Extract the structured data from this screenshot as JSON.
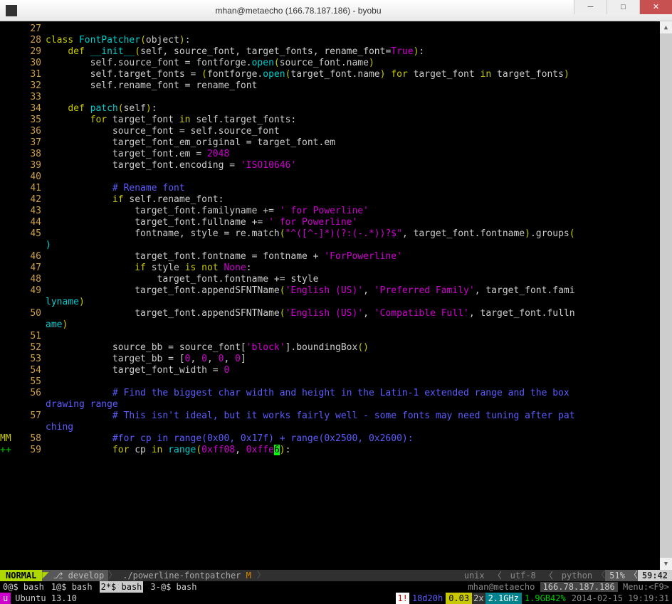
{
  "window": {
    "title": "mhan@metaecho (166.78.187.186) - byobu",
    "minimize": "─",
    "maximize": "□",
    "close": "✕"
  },
  "gutter": {
    "start": 27,
    "end": 59
  },
  "signs": {
    "58": "MM",
    "59": "++"
  },
  "code": {
    "lines": [
      {
        "n": 27,
        "raw": ""
      },
      {
        "n": 28,
        "segs": [
          [
            "kw",
            "class"
          ],
          [
            "op",
            " "
          ],
          [
            "cls",
            "FontPatcher"
          ],
          [
            "paren",
            "("
          ],
          [
            "op",
            "object"
          ],
          [
            "paren",
            ")"
          ],
          [
            "op",
            ":"
          ]
        ]
      },
      {
        "n": 29,
        "segs": [
          [
            "op",
            "    "
          ],
          [
            "kw",
            "def"
          ],
          [
            "op",
            " "
          ],
          [
            "fn",
            "__init__"
          ],
          [
            "paren",
            "("
          ],
          [
            "op",
            "self, source_font, target_fonts, rename_font="
          ],
          [
            "bool",
            "True"
          ],
          [
            "paren",
            ")"
          ],
          [
            "op",
            ":"
          ]
        ]
      },
      {
        "n": 30,
        "segs": [
          [
            "op",
            "        self.source_font = fontforge."
          ],
          [
            "fn",
            "open"
          ],
          [
            "paren",
            "("
          ],
          [
            "op",
            "source_font.name"
          ],
          [
            "paren",
            ")"
          ]
        ]
      },
      {
        "n": 31,
        "segs": [
          [
            "op",
            "        self.target_fonts = "
          ],
          [
            "paren",
            "("
          ],
          [
            "op",
            "fontforge."
          ],
          [
            "fn",
            "open"
          ],
          [
            "paren",
            "("
          ],
          [
            "op",
            "target_font.name"
          ],
          [
            "paren",
            ")"
          ],
          [
            "op",
            " "
          ],
          [
            "kw",
            "for"
          ],
          [
            "op",
            " target_font "
          ],
          [
            "kw",
            "in"
          ],
          [
            "op",
            " target_fonts"
          ],
          [
            "paren",
            ")"
          ]
        ]
      },
      {
        "n": 32,
        "segs": [
          [
            "op",
            "        self.rename_font = rename_font"
          ]
        ]
      },
      {
        "n": 33,
        "raw": ""
      },
      {
        "n": 34,
        "segs": [
          [
            "op",
            "    "
          ],
          [
            "kw",
            "def"
          ],
          [
            "op",
            " "
          ],
          [
            "fn",
            "patch"
          ],
          [
            "paren",
            "("
          ],
          [
            "op",
            "self"
          ],
          [
            "paren",
            ")"
          ],
          [
            "op",
            ":"
          ]
        ]
      },
      {
        "n": 35,
        "segs": [
          [
            "op",
            "        "
          ],
          [
            "kw",
            "for"
          ],
          [
            "op",
            " target_font "
          ],
          [
            "kw",
            "in"
          ],
          [
            "op",
            " self.target_fonts:"
          ]
        ]
      },
      {
        "n": 36,
        "segs": [
          [
            "op",
            "            source_font = self.source_font"
          ]
        ]
      },
      {
        "n": 37,
        "segs": [
          [
            "op",
            "            target_font_em_original = target_font.em"
          ]
        ]
      },
      {
        "n": 38,
        "segs": [
          [
            "op",
            "            target_font.em = "
          ],
          [
            "num",
            "2048"
          ]
        ]
      },
      {
        "n": 39,
        "segs": [
          [
            "op",
            "            target_font.encoding = "
          ],
          [
            "str",
            "'ISO10646'"
          ]
        ]
      },
      {
        "n": 40,
        "raw": ""
      },
      {
        "n": 41,
        "segs": [
          [
            "op",
            "            "
          ],
          [
            "cmt",
            "# Rename font"
          ]
        ]
      },
      {
        "n": 42,
        "segs": [
          [
            "op",
            "            "
          ],
          [
            "kw",
            "if"
          ],
          [
            "op",
            " self.rename_font:"
          ]
        ]
      },
      {
        "n": 43,
        "segs": [
          [
            "op",
            "                target_font.familyname += "
          ],
          [
            "str",
            "' for Powerline'"
          ]
        ]
      },
      {
        "n": 44,
        "segs": [
          [
            "op",
            "                target_font.fullname += "
          ],
          [
            "str",
            "' for Powerline'"
          ]
        ]
      },
      {
        "n": 45,
        "segs": [
          [
            "op",
            "                fontname, style = re.match"
          ],
          [
            "paren",
            "("
          ],
          [
            "str",
            "\"^([^-]*)(?:(-.*))?$\""
          ],
          [
            "op",
            ", target_font.fontname"
          ],
          [
            "paren",
            ")"
          ],
          [
            "op",
            ".groups"
          ],
          [
            "paren",
            "("
          ]
        ]
      },
      {
        "wrap": true,
        "segs": [
          [
            "wrap",
            ")"
          ]
        ]
      },
      {
        "n": 46,
        "segs": [
          [
            "op",
            "                target_font.fontname = fontname + "
          ],
          [
            "str",
            "'ForPowerline'"
          ]
        ]
      },
      {
        "n": 47,
        "segs": [
          [
            "op",
            "                "
          ],
          [
            "kw",
            "if"
          ],
          [
            "op",
            " style "
          ],
          [
            "kw",
            "is not"
          ],
          [
            "op",
            " "
          ],
          [
            "bool",
            "None"
          ],
          [
            "op",
            ":"
          ]
        ]
      },
      {
        "n": 48,
        "segs": [
          [
            "op",
            "                    target_font.fontname += style"
          ]
        ]
      },
      {
        "n": 49,
        "segs": [
          [
            "op",
            "                target_font.appendSFNTName"
          ],
          [
            "paren",
            "("
          ],
          [
            "str",
            "'English (US)'"
          ],
          [
            "op",
            ", "
          ],
          [
            "str",
            "'Preferred Family'"
          ],
          [
            "op",
            ", target_font.fami"
          ]
        ]
      },
      {
        "wrap": true,
        "segs": [
          [
            "wrap",
            "lyname"
          ],
          [
            "paren",
            ")"
          ]
        ]
      },
      {
        "n": 50,
        "segs": [
          [
            "op",
            "                target_font.appendSFNTName"
          ],
          [
            "paren",
            "("
          ],
          [
            "str",
            "'English (US)'"
          ],
          [
            "op",
            ", "
          ],
          [
            "str",
            "'Compatible Full'"
          ],
          [
            "op",
            ", target_font.fulln"
          ]
        ]
      },
      {
        "wrap": true,
        "segs": [
          [
            "wrap",
            "ame"
          ],
          [
            "paren",
            ")"
          ]
        ]
      },
      {
        "n": 51,
        "raw": ""
      },
      {
        "n": 52,
        "segs": [
          [
            "op",
            "            source_bb = source_font["
          ],
          [
            "str",
            "'block'"
          ],
          [
            "op",
            "].boundingBox"
          ],
          [
            "paren",
            "()"
          ]
        ]
      },
      {
        "n": 53,
        "segs": [
          [
            "op",
            "            target_bb = ["
          ],
          [
            "num",
            "0"
          ],
          [
            "op",
            ", "
          ],
          [
            "num",
            "0"
          ],
          [
            "op",
            ", "
          ],
          [
            "num",
            "0"
          ],
          [
            "op",
            ", "
          ],
          [
            "num",
            "0"
          ],
          [
            "op",
            "]"
          ]
        ]
      },
      {
        "n": 54,
        "segs": [
          [
            "op",
            "            target_font_width = "
          ],
          [
            "num",
            "0"
          ]
        ]
      },
      {
        "n": 55,
        "raw": ""
      },
      {
        "n": 56,
        "segs": [
          [
            "op",
            "            "
          ],
          [
            "cmt",
            "# Find the biggest char width and height in the Latin-1 extended range and the box "
          ]
        ]
      },
      {
        "wrap": true,
        "segs": [
          [
            "cmt",
            "drawing range"
          ]
        ]
      },
      {
        "n": 57,
        "segs": [
          [
            "op",
            "            "
          ],
          [
            "cmt",
            "# This isn't ideal, but it works fairly well - some fonts may need tuning after pat"
          ]
        ]
      },
      {
        "wrap": true,
        "segs": [
          [
            "cmt",
            "ching"
          ]
        ]
      },
      {
        "n": 58,
        "segs": [
          [
            "op",
            "            "
          ],
          [
            "cmt",
            "#for cp in range(0x00, 0x17f) + range(0x2500, 0x2600):"
          ]
        ]
      },
      {
        "n": 59,
        "segs": [
          [
            "op",
            "            "
          ],
          [
            "kw",
            "for"
          ],
          [
            "op",
            " cp "
          ],
          [
            "kw",
            "in"
          ],
          [
            "op",
            " "
          ],
          [
            "fn",
            "range"
          ],
          [
            "paren",
            "("
          ],
          [
            "num",
            "0xff08"
          ],
          [
            "op",
            ", "
          ],
          [
            "num",
            "0xffe"
          ],
          [
            "cursor",
            "6"
          ],
          [
            "paren",
            ")"
          ],
          [
            "op",
            ":"
          ]
        ]
      }
    ]
  },
  "statusline": {
    "mode": "NORMAL",
    "branch": "⎇ develop",
    "file": "./powerline-fontpatcher",
    "modified": "M",
    "unix": "unix",
    "encoding": "utf-8",
    "filetype": "python",
    "percent": "51%",
    "pos": "59:42"
  },
  "tmux": {
    "windows": [
      {
        "id": "0@$",
        "name": "bash",
        "active": false
      },
      {
        "id": "1@$",
        "name": "bash",
        "active": false
      },
      {
        "id": "2*$",
        "name": "bash",
        "active": true
      },
      {
        "id": "3-@$",
        "name": "bash",
        "active": false
      }
    ],
    "user": "mhan@metaecho",
    "ip": "166.78.187.186",
    "menu": "Menu:<F9>"
  },
  "sys": {
    "distro_badge": "u",
    "distro": "Ubuntu 13.10",
    "updates": "1!",
    "uptime": "18d20h",
    "load": "0.03",
    "cpu": "2x",
    "freq": "2.1GHz",
    "mem": "1.9GB42%",
    "date": "2014-02-15 19:19:31"
  }
}
